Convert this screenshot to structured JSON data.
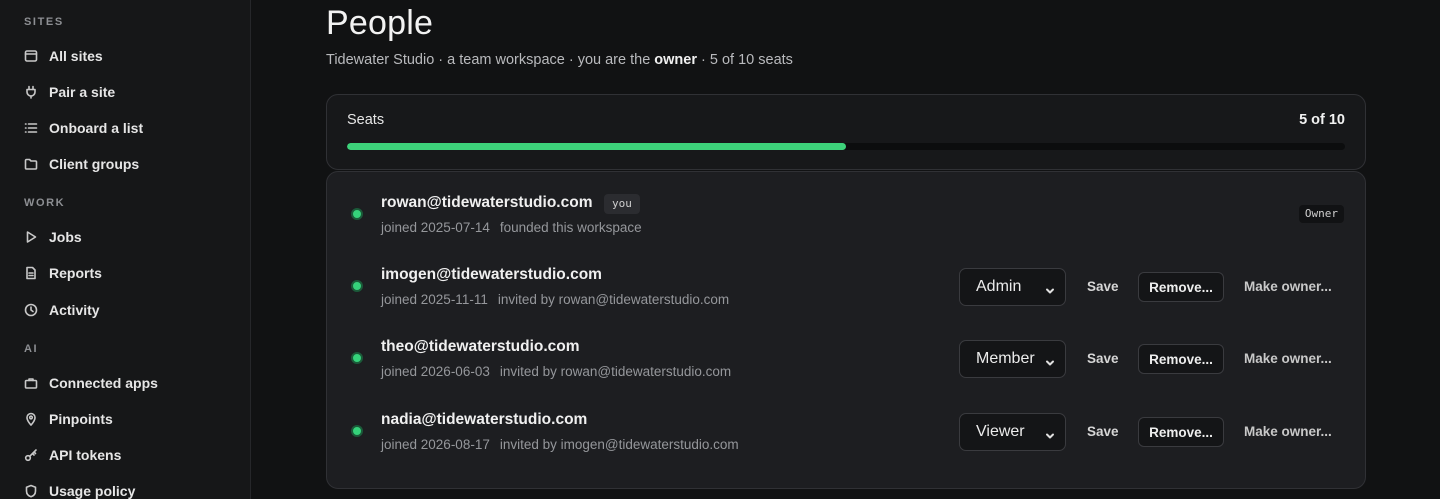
{
  "sidebar": {
    "sections": [
      {
        "label": "SITES",
        "items": [
          {
            "label": "All sites",
            "icon": "browser-window-icon"
          },
          {
            "label": "Pair a site",
            "icon": "plug-icon"
          },
          {
            "label": "Onboard a list",
            "icon": "list-icon"
          },
          {
            "label": "Client groups",
            "icon": "folder-icon"
          }
        ]
      },
      {
        "label": "WORK",
        "items": [
          {
            "label": "Jobs",
            "icon": "play-icon"
          },
          {
            "label": "Reports",
            "icon": "document-icon"
          },
          {
            "label": "Activity",
            "icon": "clock-icon"
          }
        ]
      },
      {
        "label": "AI",
        "items": [
          {
            "label": "Connected apps",
            "icon": "briefcase-icon"
          },
          {
            "label": "Pinpoints",
            "icon": "map-pin-icon"
          },
          {
            "label": "API tokens",
            "icon": "key-icon"
          },
          {
            "label": "Usage policy",
            "icon": "shield-icon"
          }
        ]
      }
    ]
  },
  "header": {
    "title": "People",
    "subtitle_prefix": "Tidewater Studio · a team workspace · you are the ",
    "subtitle_role": "owner",
    "subtitle_suffix": " · 5 of 10 seats"
  },
  "seats": {
    "label": "Seats",
    "count_text": "5 of 10",
    "used": 5,
    "total": 10
  },
  "members": [
    {
      "email": "rowan@tidewaterstudio.com",
      "you_badge": "you",
      "joined": "joined 2025-07-14",
      "detail": "founded this workspace",
      "role_badge": "Owner"
    },
    {
      "email": "imogen@tidewaterstudio.com",
      "joined": "joined 2025-11-11",
      "detail": "invited by rowan@tidewaterstudio.com",
      "role": "Admin",
      "save_label": "Save",
      "remove_label": "Remove...",
      "make_owner_label": "Make owner..."
    },
    {
      "email": "theo@tidewaterstudio.com",
      "joined": "joined 2026-06-03",
      "detail": "invited by rowan@tidewaterstudio.com",
      "role": "Member",
      "save_label": "Save",
      "remove_label": "Remove...",
      "make_owner_label": "Make owner..."
    },
    {
      "email": "nadia@tidewaterstudio.com",
      "joined": "joined 2026-08-17",
      "detail": "invited by imogen@tidewaterstudio.com",
      "role": "Viewer",
      "save_label": "Save",
      "remove_label": "Remove...",
      "make_owner_label": "Make owner..."
    }
  ],
  "colors": {
    "accent_green": "#3dd27a",
    "background": "#111213",
    "card": "#1d1e21"
  }
}
